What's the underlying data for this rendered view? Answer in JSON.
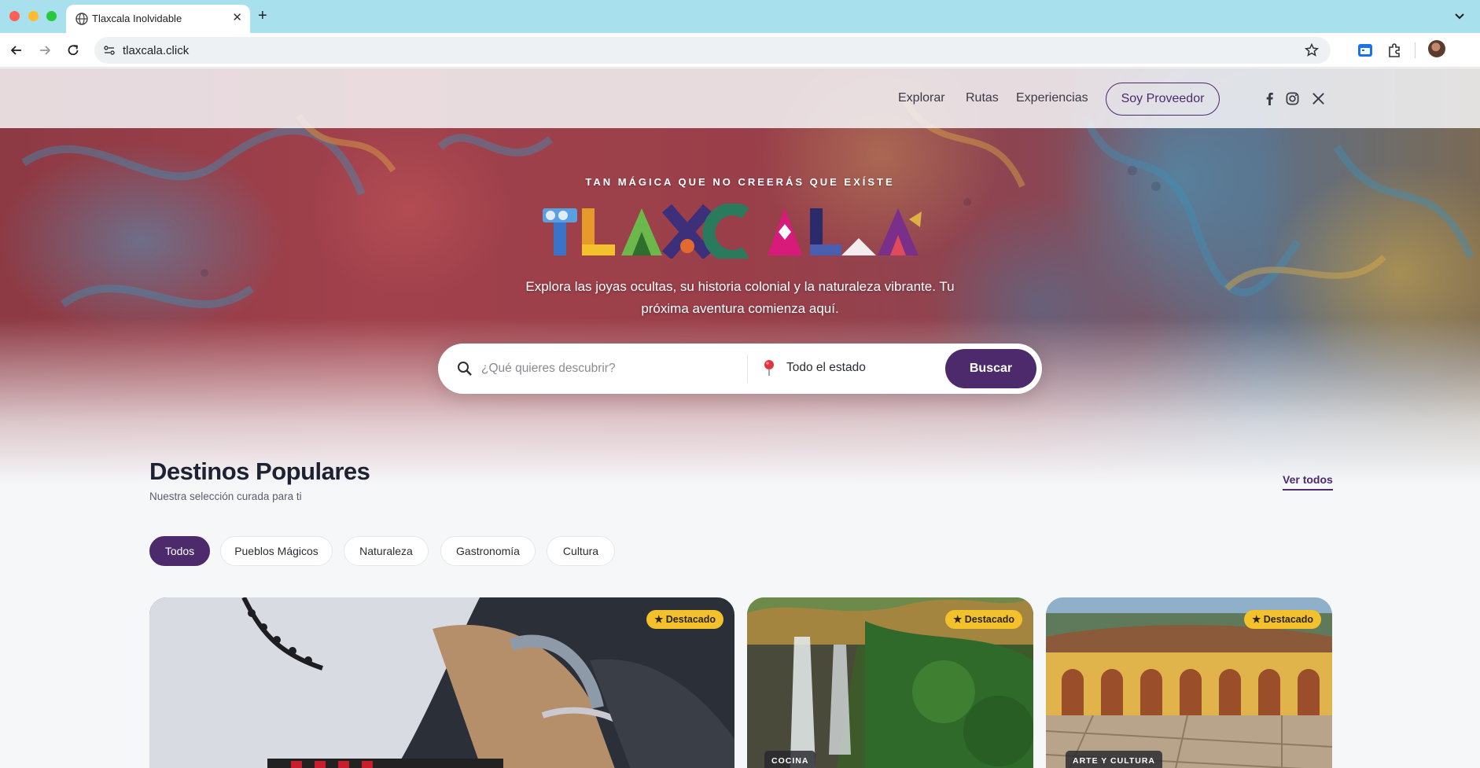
{
  "browser": {
    "tab_title": "Tlaxcala Inolvidable",
    "url": "tlaxcala.click"
  },
  "nav": {
    "links": [
      "Explorar",
      "Rutas",
      "Experiencias"
    ],
    "provider_button": "Soy Proveedor",
    "social": [
      "facebook-icon",
      "instagram-icon",
      "x-icon"
    ]
  },
  "hero": {
    "tagline": "TAN MÁGICA QUE NO CREERÁS QUE EXÍSTE",
    "logo_text": "TLAXCALA",
    "subtitle_line1": "Explora las joyas ocultas, su historia colonial y la naturaleza vibrante. Tu",
    "subtitle_line2": "próxima aventura comienza aquí."
  },
  "search": {
    "placeholder": "¿Qué quieres descubrir?",
    "location": "Todo el estado",
    "button": "Buscar"
  },
  "section": {
    "title": "Destinos Populares",
    "subtitle": "Nuestra selección curada para ti",
    "see_all": "Ver todos"
  },
  "filters": [
    "Todos",
    "Pueblos Mágicos",
    "Naturaleza",
    "Gastronomía",
    "Cultura"
  ],
  "cards": [
    {
      "badge": "★ Destacado",
      "category": ""
    },
    {
      "badge": "★ Destacado",
      "category": "COCINA"
    },
    {
      "badge": "★ Destacado",
      "category": "ARTE Y CULTURA"
    }
  ],
  "colors": {
    "brand_purple": "#4c2a6b",
    "badge_yellow": "#f2c12b",
    "tab_bar": "#a9e0ee"
  }
}
